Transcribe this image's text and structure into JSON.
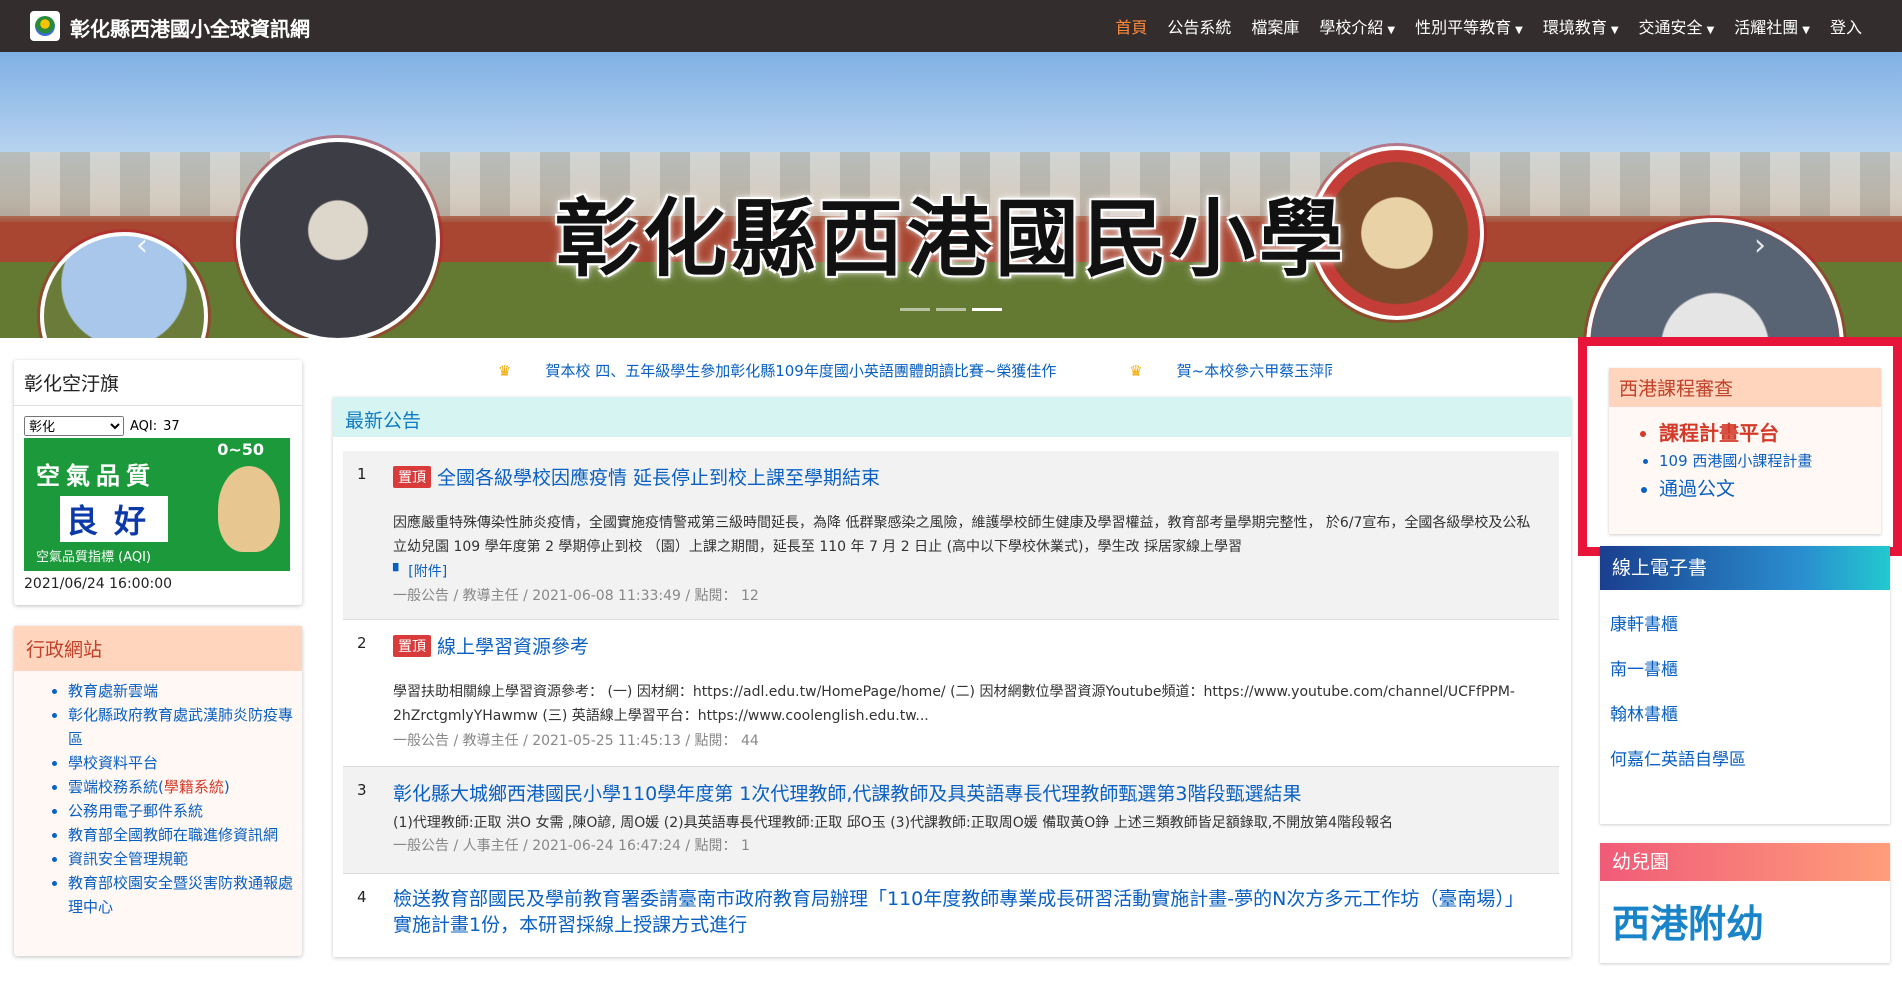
{
  "header": {
    "site_title": "彰化縣西港國小全球資訊網",
    "nav": [
      {
        "label": "首頁",
        "active": true,
        "dropdown": false
      },
      {
        "label": "公告系統",
        "dropdown": false
      },
      {
        "label": "檔案庫",
        "dropdown": false
      },
      {
        "label": "學校介紹",
        "dropdown": true
      },
      {
        "label": "性別平等教育",
        "dropdown": true
      },
      {
        "label": "環境教育",
        "dropdown": true
      },
      {
        "label": "交通安全",
        "dropdown": true
      },
      {
        "label": "活耀社團",
        "dropdown": true
      },
      {
        "label": "登入",
        "dropdown": false
      }
    ]
  },
  "banner": {
    "title": "彰化縣西港國民小學",
    "active_slide": 3,
    "slides": 3
  },
  "air_quality": {
    "title": "彰化空汙旗",
    "select_value": "彰化",
    "aqi_label": "AQI:",
    "aqi_value": "37",
    "image_text_1": "空氣品質",
    "image_text_2": "良好",
    "image_text_3": "空氣品質指標 (AQI)",
    "image_range": "0~50",
    "timestamp": "2021/06/24 16:00:00"
  },
  "admin_links": {
    "title": "行政網站",
    "items": [
      {
        "label": "教育處新雲端"
      },
      {
        "label": "彰化縣政府教育處武漢肺炎防疫專區"
      },
      {
        "label": "學校資料平台"
      },
      {
        "label": "雲端校務系統(",
        "extra": "學籍系統",
        "suffix": ")"
      },
      {
        "label": "公務用電子郵件系統"
      },
      {
        "label": "教育部全國教師在職進修資訊網"
      },
      {
        "label": "資訊安全管理規範"
      },
      {
        "label": "教育部校園安全暨災害防救通報處理中心"
      }
    ]
  },
  "marquee": {
    "items": [
      "賀本校 四、五年級學生參加彰化縣109年度國小英語團體朗讀比賽~榮獲佳作",
      "賀~本校參六甲蔡玉萍同學參加"
    ]
  },
  "news": {
    "title": "最新公告",
    "pin_label": "置頂",
    "attach_label": "[附件]",
    "rows": [
      {
        "num": "1",
        "pinned": true,
        "title": "全國各級學校因應疫情 延長停止到校上課至學期結束",
        "body": "因應嚴重特殊傳染性肺炎疫情，全國實施疫情警戒第三級時間延長，為降 低群聚感染之風險，維護學校師生健康及學習權益，教育部考量學期完整性， 於6/7宣布，全國各級學校及公私立幼兒園 109 學年度第 2 學期停止到校 （園）上課之期間，延長至 110 年 7 月 2 日止 (高中以下學校休業式)，學生改 採居家線上學習",
        "meta": "一般公告 / 教導主任 / 2021-06-08 11:33:49 / 點閱： 12"
      },
      {
        "num": "2",
        "pinned": true,
        "title": "線上學習資源參考",
        "body": "學習扶助相關線上學習資源參考： (一) 因材網：https://adl.edu.tw/HomePage/home/ (二) 因材網數位學習資源Youtube頻道：https://www.youtube.com/channel/UCFfPPM-2hZrctgmlyYHawmw (三) 英語線上學習平台：https://www.coolenglish.edu.tw...",
        "meta": "一般公告 / 教導主任 / 2021-05-25 11:45:13 / 點閱： 44"
      },
      {
        "num": "3",
        "pinned": false,
        "title": "彰化縣大城鄉西港國民小學110學年度第 1次代理教師,代課教師及具英語專長代理教師甄選第3階段甄選結果",
        "body": "(1)代理教師:正取 洪O 女需 ,陳O諺, 周O媛 (2)具英語專長代理教師:正取 邱O玉 (3)代課教師:正取周O媛 備取黃O錚 上述三類教師皆足額錄取,不開放第4階段報名",
        "meta": "一般公告 / 人事主任 / 2021-06-24 16:47:24 / 點閱： 1"
      },
      {
        "num": "4",
        "pinned": false,
        "title": "檢送教育部國民及學前教育署委請臺南市政府教育局辦理「110年度教師專業成長研習活動實施計畫-夢的N次方多元工作坊（臺南場）」實施計畫1份，本研習採線上授課方式進行"
      }
    ]
  },
  "curriculum": {
    "title": "西港課程審查",
    "items": [
      {
        "label": "課程計畫平台"
      },
      {
        "label": "109 西港國小課程計畫"
      },
      {
        "label": "通過公文"
      }
    ]
  },
  "ebooks": {
    "title": "線上電子書",
    "items": [
      "康軒書櫃",
      "南一書櫃",
      "翰林書櫃",
      "何嘉仁英語自學區"
    ]
  },
  "kindergarten": {
    "title": "幼兒園",
    "big_text": "西港附幼"
  },
  "colors": {
    "topbar": "#332d2d",
    "nav_active": "#ff8a3d",
    "link": "#0a60c2",
    "highlight_border": "#e8153a",
    "pin_badge": "#d93a3a"
  }
}
